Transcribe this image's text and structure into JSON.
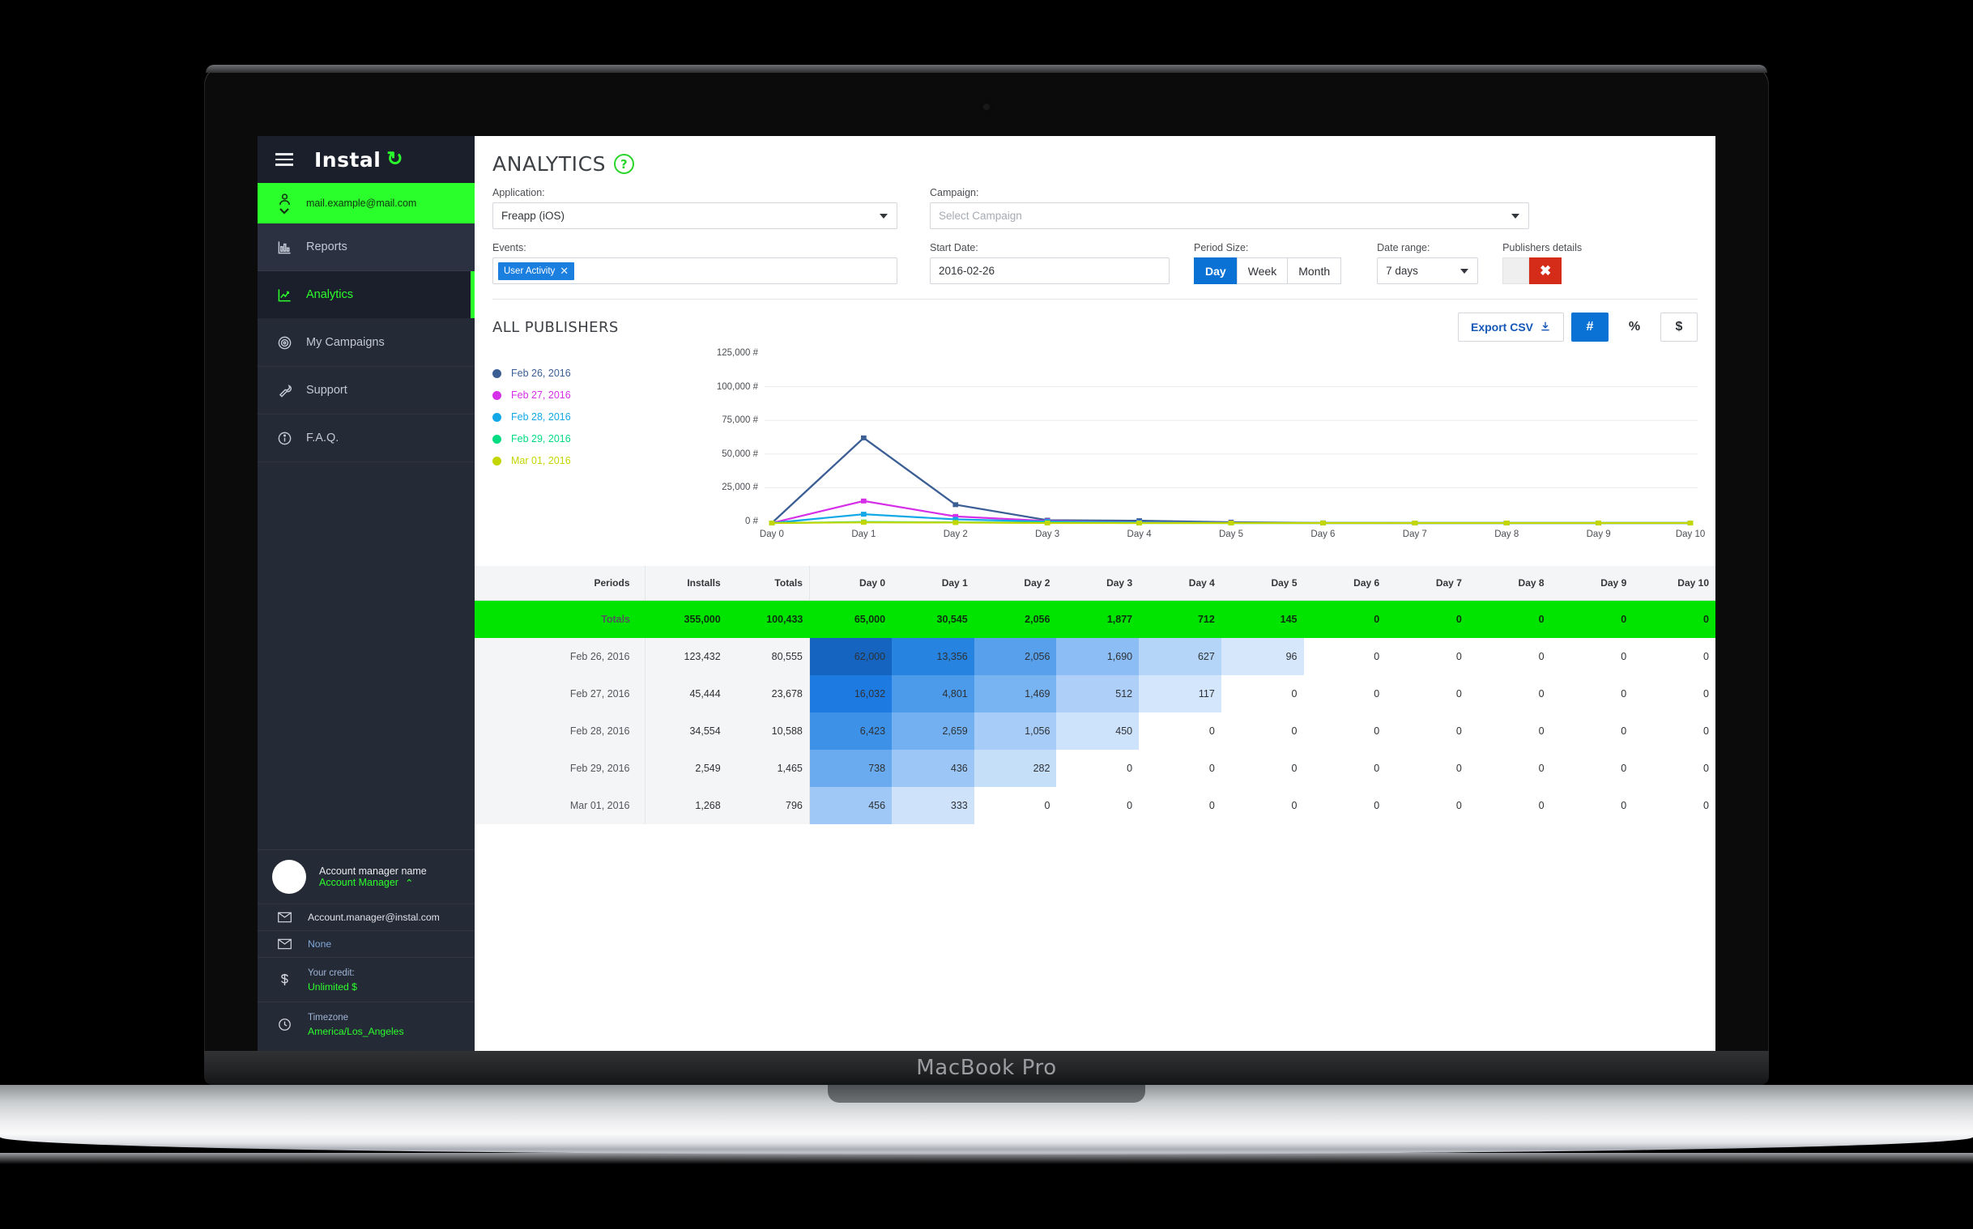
{
  "device": {
    "label": "MacBook Pro"
  },
  "sidebar": {
    "brand": {
      "name": "Instal",
      "mark": "↻"
    },
    "account": {
      "email": "mail.example@mail.com",
      "icon": "user-icon",
      "chevron": "⌄"
    },
    "items": [
      {
        "label": "Reports",
        "icon": "bar-chart-icon",
        "active": false
      },
      {
        "label": "Analytics",
        "icon": "line-chart-icon",
        "active": true
      },
      {
        "label": "My Campaigns",
        "icon": "target-icon",
        "active": false
      },
      {
        "label": "Support",
        "icon": "wrench-icon",
        "active": false
      },
      {
        "label": "F.A.Q.",
        "icon": "info-icon",
        "active": false
      }
    ],
    "account_manager": {
      "name": "Account manager name",
      "role": "Account Manager",
      "role_chevron": "⌃",
      "email": "Account.manager@instal.com",
      "secondary_contact": "None",
      "credit_label": "Your credit:",
      "credit_value": "Unlimited $",
      "timezone_label": "Timezone",
      "timezone_value": "America/Los_Angeles"
    }
  },
  "header": {
    "title": "ANALYTICS",
    "help": "?"
  },
  "filters": {
    "application": {
      "label": "Application:",
      "value": "Freapp (iOS)"
    },
    "campaign": {
      "label": "Campaign:",
      "placeholder": "Select Campaign"
    },
    "events": {
      "label": "Events:",
      "tag": "User Activity",
      "remove": "✕"
    },
    "start_date": {
      "label": "Start Date:",
      "value": "2016-02-26"
    },
    "period_size": {
      "label": "Period Size:",
      "options": [
        "Day",
        "Week",
        "Month"
      ],
      "selected": "Day"
    },
    "date_range": {
      "label": "Date range:",
      "value": "7 days"
    },
    "publishers_details": {
      "label": "Publishers details",
      "state": "✖"
    }
  },
  "section": {
    "title": "ALL PUBLISHERS",
    "export_label": "Export CSV",
    "export_icon": "download-icon",
    "units": [
      "#",
      "%",
      "$"
    ],
    "unit_selected": "#"
  },
  "chart_data": {
    "type": "line",
    "title": "ALL PUBLISHERS",
    "xlabel": "",
    "ylabel": "",
    "grid": true,
    "legend_position": "left",
    "x": [
      "Day 0",
      "Day 1",
      "Day 2",
      "Day 3",
      "Day 4",
      "Day 5",
      "Day 6",
      "Day 7",
      "Day 8",
      "Day 9",
      "Day 10"
    ],
    "yticks": [
      "0 #",
      "25,000 #",
      "50,000 #",
      "75,000 #",
      "100,000 #",
      "125,000 #"
    ],
    "ytick_values": [
      0,
      25000,
      50000,
      75000,
      100000,
      125000
    ],
    "ylim": [
      0,
      125000
    ],
    "series": [
      {
        "name": "Feb 26, 2016",
        "color": "#3b5e94",
        "values": [
          0,
          62000,
          13356,
          2056,
          1690,
          627,
          96,
          0,
          0,
          0,
          0
        ]
      },
      {
        "name": "Feb 27, 2016",
        "color": "#d62fe8",
        "values": [
          0,
          16032,
          4801,
          1469,
          512,
          117,
          0,
          0,
          0,
          0,
          0
        ]
      },
      {
        "name": "Feb 28, 2016",
        "color": "#12a8e8",
        "values": [
          0,
          6423,
          2659,
          1056,
          450,
          0,
          0,
          0,
          0,
          0,
          0
        ]
      },
      {
        "name": "Feb 29, 2016",
        "color": "#00dc82",
        "values": [
          0,
          738,
          436,
          282,
          0,
          0,
          0,
          0,
          0,
          0,
          0
        ]
      },
      {
        "name": "Mar 01, 2016",
        "color": "#c4d600",
        "values": [
          0,
          456,
          333,
          0,
          0,
          0,
          0,
          0,
          0,
          0,
          0
        ]
      }
    ]
  },
  "table": {
    "columns": [
      "Periods",
      "Installs",
      "Totals",
      "Day 0",
      "Day 1",
      "Day 2",
      "Day 3",
      "Day 4",
      "Day 5",
      "Day 6",
      "Day 7",
      "Day 8",
      "Day 9",
      "Day 10"
    ],
    "totals_row": [
      "Totals",
      "355,000",
      "100,433",
      "65,000",
      "30,545",
      "2,056",
      "1,877",
      "712",
      "145",
      "0",
      "0",
      "0",
      "0",
      "0"
    ],
    "rows": [
      {
        "cells": [
          "Feb 26, 2016",
          "123,432",
          "80,555",
          "62,000",
          "13,356",
          "2,056",
          "1,690",
          "627",
          "96",
          "0",
          "0",
          "0",
          "0",
          "0"
        ],
        "heat": [
          null,
          null,
          null,
          "#1565c0",
          "#2684e0",
          "#58a0ec",
          "#8cbdf4",
          "#b4d4f8",
          "#d6e7fb",
          null,
          null,
          null,
          null,
          null
        ]
      },
      {
        "cells": [
          "Feb 27, 2016",
          "45,444",
          "23,678",
          "16,032",
          "4,801",
          "1,469",
          "512",
          "117",
          "0",
          "0",
          "0",
          "0",
          "0",
          "0"
        ],
        "heat": [
          null,
          null,
          null,
          "#1d7ae0",
          "#4c9aea",
          "#79b4f2",
          "#aed0f8",
          "#d3e6fb",
          null,
          null,
          null,
          null,
          null,
          null
        ]
      },
      {
        "cells": [
          "Feb 28, 2016",
          "34,554",
          "10,588",
          "6,423",
          "2,659",
          "1,056",
          "450",
          "0",
          "0",
          "0",
          "0",
          "0",
          "0",
          "0"
        ],
        "heat": [
          null,
          null,
          null,
          "#3d92e7",
          "#72b0f1",
          "#a7ccf7",
          "#cde2fb",
          null,
          null,
          null,
          null,
          null,
          null,
          null
        ]
      },
      {
        "cells": [
          "Feb 29, 2016",
          "2,549",
          "1,465",
          "738",
          "436",
          "282",
          "0",
          "0",
          "0",
          "0",
          "0",
          "0",
          "0",
          "0"
        ],
        "heat": [
          null,
          null,
          null,
          "#6aabf0",
          "#9cc6f6",
          "#c6dff9",
          null,
          null,
          null,
          null,
          null,
          null,
          null,
          null
        ]
      },
      {
        "cells": [
          "Mar 01, 2016",
          "1,268",
          "796",
          "456",
          "333",
          "0",
          "0",
          "0",
          "0",
          "0",
          "0",
          "0",
          "0",
          "0"
        ],
        "heat": [
          null,
          null,
          null,
          "#9fc8f6",
          "#cee2fa",
          null,
          null,
          null,
          null,
          null,
          null,
          null,
          null,
          null
        ]
      }
    ]
  }
}
